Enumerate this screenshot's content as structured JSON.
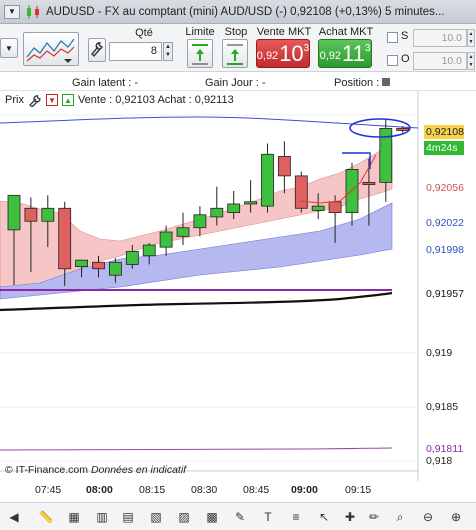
{
  "window": {
    "title_icon": "candlestick-icon",
    "title": "AUDUSD - FX au comptant  (mini) AUD/USD (-)   0,92108 (+0,13%)     5 minutes..."
  },
  "toolbar": {
    "qty_label": "Qté",
    "qty_value": "8",
    "limit_label": "Limite",
    "stop_label": "Stop",
    "sell_label": "Vente MKT",
    "sell_prefix": "0,92",
    "sell_big": "10",
    "sell_sup": "3",
    "buy_label": "Achat MKT",
    "buy_prefix": "0,92",
    "buy_big": "11",
    "buy_sup": "3",
    "s_label": "S",
    "o_label": "O",
    "s_value": "10.0",
    "o_value": "10.0"
  },
  "gains": {
    "latent": "Gain latent : -",
    "jour": "Gain Jour : -",
    "position": "Position : 0"
  },
  "chart_header": {
    "prix": "Prix",
    "quotes": "Vente : 0,92103  Achat : 0,92113"
  },
  "price_labels": {
    "current": "0,92108",
    "timer": "4m24s",
    "upper_band": "0,92056",
    "band_mid": "0,92022",
    "band_low": "0,91998",
    "ma_long": "0,91957",
    "lower_env": "0,91811"
  },
  "axis": {
    "y_ticks": [
      "0,919",
      "0,9185",
      "0,918"
    ],
    "x_ticks": [
      "07:45",
      "08:00",
      "08:15",
      "08:30",
      "08:45",
      "09:00",
      "09:15"
    ]
  },
  "credit": {
    "brand": "© IT-Finance.com",
    "note": "Données en indicatif"
  },
  "colors": {
    "bull": "#3fbf3f",
    "bear": "#e06060",
    "sell_bg": "#d23b3d",
    "buy_bg": "#3aac3a",
    "upper_band_fill": "#f6c9c9",
    "lower_band_fill": "#b9bdf2",
    "ma_purple": "#8a2aa8",
    "ma_black": "#111111",
    "envelope_blue": "#3050d8"
  },
  "chart_data": {
    "type": "candlestick",
    "ylabel": "",
    "xlabel": "",
    "y_ticks": [
      0.919,
      0.9185,
      0.918
    ],
    "candles": [
      {
        "o": 0.92014,
        "h": 0.92038,
        "l": 0.91963,
        "c": 0.92046
      },
      {
        "o": 0.92034,
        "h": 0.92044,
        "l": 0.91975,
        "c": 0.92022
      },
      {
        "o": 0.92022,
        "h": 0.92046,
        "l": 0.91998,
        "c": 0.92034
      },
      {
        "o": 0.92034,
        "h": 0.9204,
        "l": 0.91962,
        "c": 0.91978
      },
      {
        "o": 0.9198,
        "h": 0.91986,
        "l": 0.9197,
        "c": 0.91986
      },
      {
        "o": 0.91984,
        "h": 0.9199,
        "l": 0.9197,
        "c": 0.91978
      },
      {
        "o": 0.91972,
        "h": 0.91988,
        "l": 0.91965,
        "c": 0.91984
      },
      {
        "o": 0.91982,
        "h": 0.92,
        "l": 0.91978,
        "c": 0.91994
      },
      {
        "o": 0.9199,
        "h": 0.92002,
        "l": 0.91982,
        "c": 0.92
      },
      {
        "o": 0.91998,
        "h": 0.92018,
        "l": 0.9199,
        "c": 0.92012
      },
      {
        "o": 0.92008,
        "h": 0.9203,
        "l": 0.92,
        "c": 0.92016
      },
      {
        "o": 0.92016,
        "h": 0.92036,
        "l": 0.92008,
        "c": 0.92028
      },
      {
        "o": 0.92026,
        "h": 0.92054,
        "l": 0.92018,
        "c": 0.92034
      },
      {
        "o": 0.9203,
        "h": 0.9205,
        "l": 0.92024,
        "c": 0.92038
      },
      {
        "o": 0.92038,
        "h": 0.9206,
        "l": 0.9203,
        "c": 0.9204
      },
      {
        "o": 0.92036,
        "h": 0.92094,
        "l": 0.9203,
        "c": 0.92084
      },
      {
        "o": 0.92082,
        "h": 0.92096,
        "l": 0.92048,
        "c": 0.92064
      },
      {
        "o": 0.92064,
        "h": 0.92068,
        "l": 0.9203,
        "c": 0.92034
      },
      {
        "o": 0.92032,
        "h": 0.92048,
        "l": 0.92024,
        "c": 0.92036
      },
      {
        "o": 0.9204,
        "h": 0.92046,
        "l": 0.92002,
        "c": 0.9203
      },
      {
        "o": 0.9203,
        "h": 0.92076,
        "l": 0.92018,
        "c": 0.9207
      },
      {
        "o": 0.92058,
        "h": 0.9208,
        "l": 0.92018,
        "c": 0.92056
      },
      {
        "o": 0.92058,
        "h": 0.92116,
        "l": 0.9204,
        "c": 0.92108
      },
      {
        "o": 0.92108,
        "h": 0.9211,
        "l": 0.92104,
        "c": 0.92106
      }
    ]
  }
}
